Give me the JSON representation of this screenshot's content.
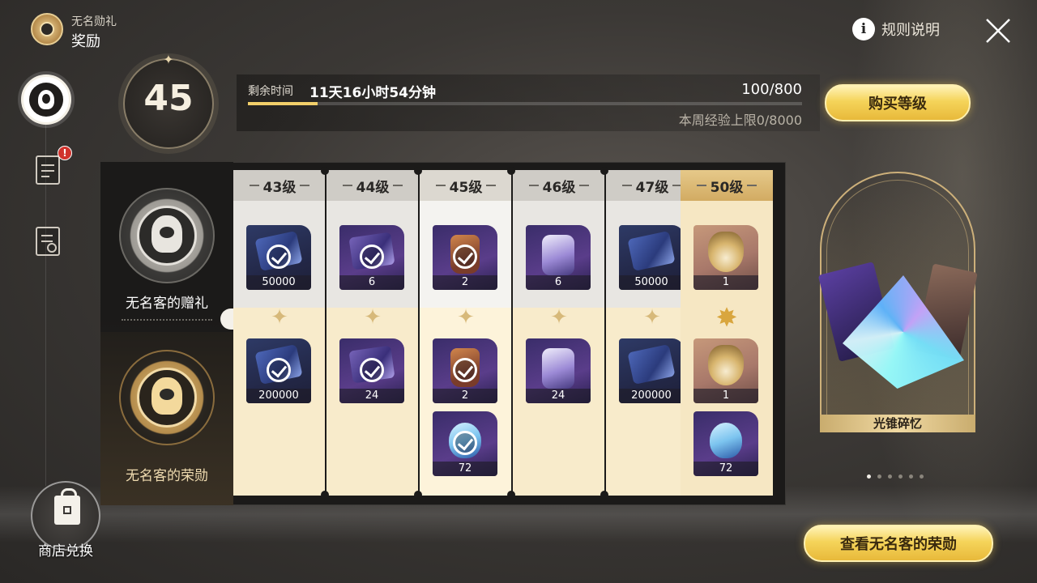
{
  "header": {
    "subtitle": "无名勋礼",
    "title": "奖励",
    "rules_label": "规则说明"
  },
  "rail": {
    "shop_label": "商店兑换",
    "badge_text": "!"
  },
  "level": {
    "current": "45",
    "time_label": "剩余时间",
    "time_value": "11天16小时54分钟",
    "exp_value": "100/800",
    "exp_progress": 0.125,
    "weekly_cap": "本周经验上限0/8000",
    "buy_label": "购买等级"
  },
  "tracks": {
    "free_name": "无名客的赠礼",
    "premium_name": "无名客的荣勋"
  },
  "columns": [
    {
      "level": "43级",
      "free": {
        "qty": "50000",
        "claimed": true
      },
      "premium": [
        {
          "qty": "200000",
          "claimed": true
        }
      ]
    },
    {
      "level": "44级",
      "free": {
        "qty": "6",
        "claimed": true
      },
      "premium": [
        {
          "qty": "24",
          "claimed": true
        }
      ]
    },
    {
      "level": "45级",
      "free": {
        "qty": "2",
        "claimed": true
      },
      "premium": [
        {
          "qty": "2",
          "claimed": true
        },
        {
          "qty": "72",
          "claimed": true
        }
      ]
    },
    {
      "level": "46级",
      "free": {
        "qty": "6",
        "claimed": false
      },
      "premium": [
        {
          "qty": "24",
          "claimed": false
        }
      ]
    },
    {
      "level": "47级",
      "free": {
        "qty": "50000",
        "claimed": false
      },
      "premium": [
        {
          "qty": "200000",
          "claimed": false
        }
      ]
    },
    {
      "level": "50级",
      "free": {
        "qty": "1",
        "claimed": false
      },
      "premium": [
        {
          "qty": "1",
          "claimed": false
        },
        {
          "qty": "72",
          "claimed": false
        }
      ]
    }
  ],
  "preview": {
    "label": "光锥碎忆",
    "page_count": 6,
    "active_page": 1
  },
  "honor_button": "查看无名客的荣勋",
  "colors": {
    "gold_accent": "#f2cf6a",
    "progress_fill": "#f2cf6a",
    "badge_red": "#d0322c"
  }
}
